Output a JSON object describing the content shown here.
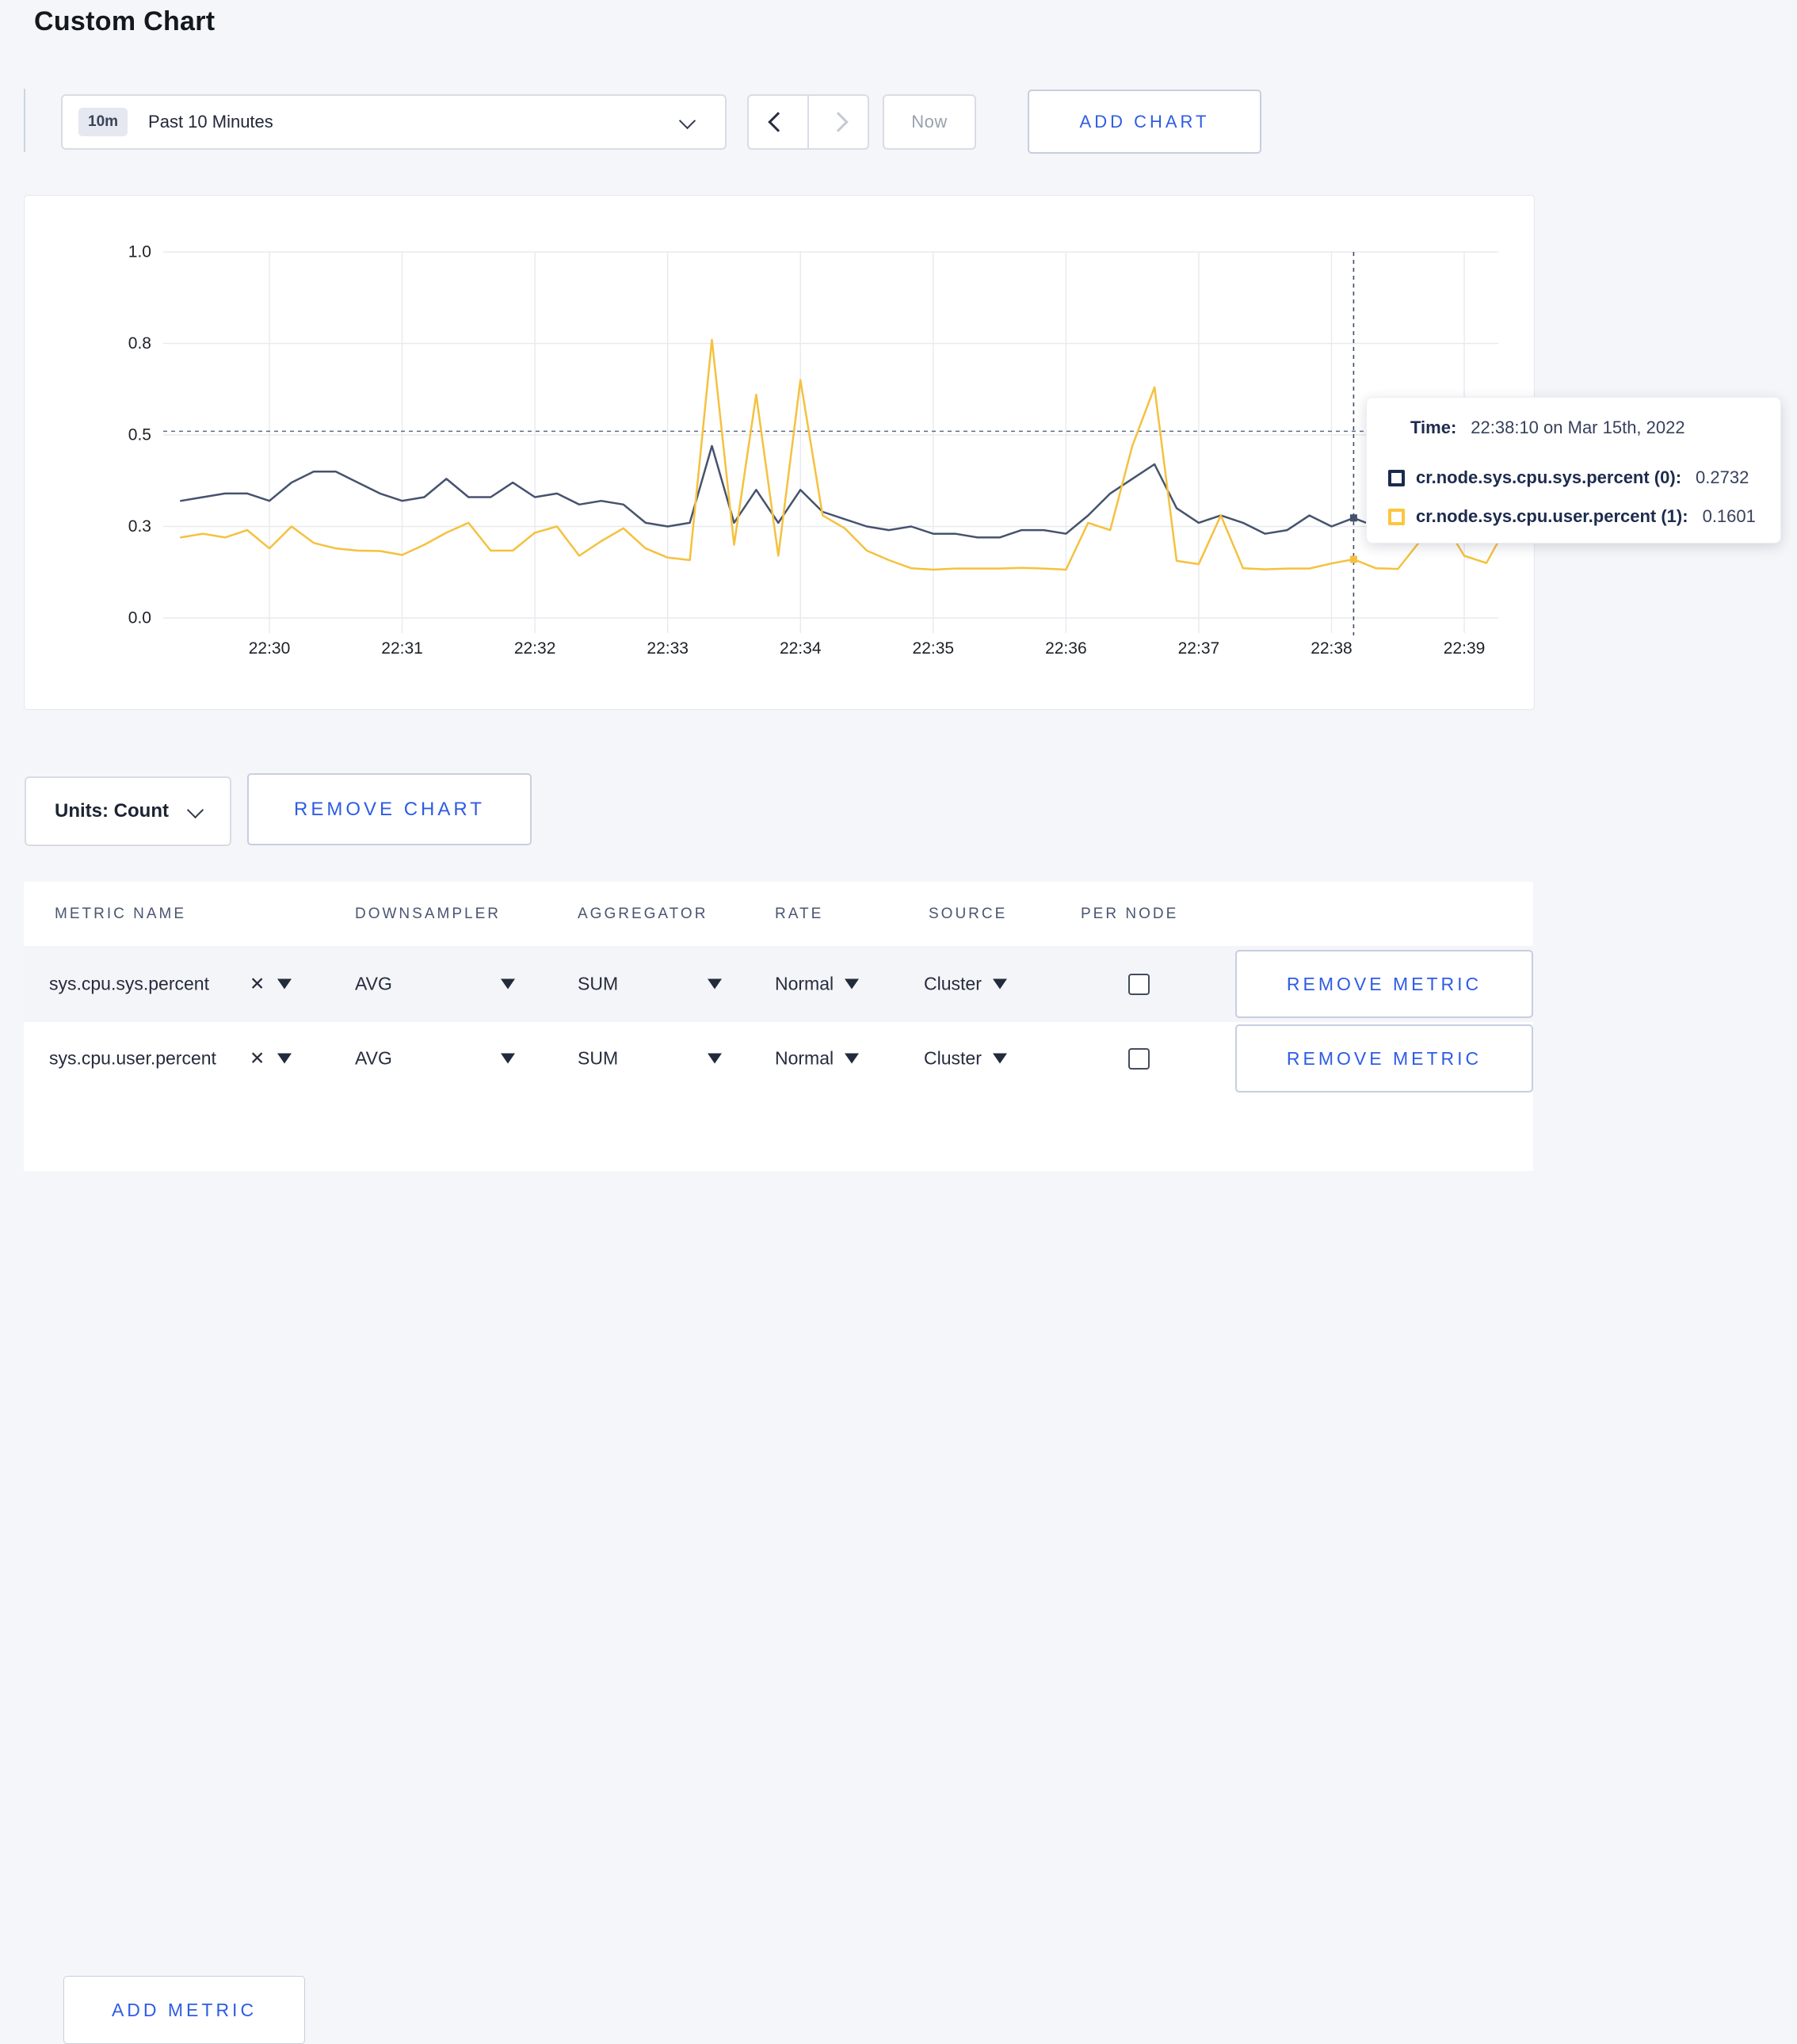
{
  "page": {
    "title": "Custom Chart"
  },
  "colors": {
    "accent_blue": "#2e5ce4",
    "series_sys": "#46536e",
    "series_user": "#f5c13e",
    "tooltip_navy": "#1b2b4e",
    "tooltip_yellow": "#fdc53e"
  },
  "toolbar": {
    "timeframe_badge": "10m",
    "timeframe_label": "Past 10 Minutes",
    "now_label": "Now",
    "add_chart_label": "ADD CHART"
  },
  "tooltip": {
    "time_label": "Time:",
    "time_value": "22:38:10 on Mar 15th, 2022",
    "rows": [
      {
        "label": "cr.node.sys.cpu.sys.percent (0):",
        "value": "0.2732",
        "color": "#1b2b4e"
      },
      {
        "label": "cr.node.sys.cpu.user.percent (1):",
        "value": "0.1601",
        "color": "#fdc53e"
      }
    ]
  },
  "chart_controls": {
    "units_label": "Units: Count",
    "remove_chart_label": "REMOVE CHART"
  },
  "metrics_table": {
    "headers": [
      "METRIC NAME",
      "DOWNSAMPLER",
      "AGGREGATOR",
      "RATE",
      "SOURCE",
      "PER NODE"
    ],
    "rows": [
      {
        "metric": "sys.cpu.sys.percent",
        "downsampler": "AVG",
        "aggregator": "SUM",
        "rate": "Normal",
        "source": "Cluster",
        "per_node": false
      },
      {
        "metric": "sys.cpu.user.percent",
        "downsampler": "AVG",
        "aggregator": "SUM",
        "rate": "Normal",
        "source": "Cluster",
        "per_node": false
      }
    ],
    "remove_metric_label": "REMOVE METRIC",
    "add_metric_label": "ADD METRIC"
  },
  "chart_data": {
    "type": "line",
    "title": "",
    "xlabel": "",
    "ylabel": "",
    "ylim": [
      0,
      1
    ],
    "grid": true,
    "x_ticks": [
      "22:30",
      "22:31",
      "22:32",
      "22:33",
      "22:34",
      "22:35",
      "22:36",
      "22:37",
      "22:38",
      "22:39"
    ],
    "y_ticks": {
      "values": [
        0,
        0.25,
        0.5,
        0.75,
        1.0
      ],
      "labels": [
        "0.0",
        "0.3",
        "0.5",
        "0.8",
        "1.0"
      ]
    },
    "x": [
      "22:29:20",
      "22:29:30",
      "22:29:40",
      "22:29:50",
      "22:30:00",
      "22:30:10",
      "22:30:20",
      "22:30:30",
      "22:30:40",
      "22:30:50",
      "22:31:00",
      "22:31:10",
      "22:31:20",
      "22:31:30",
      "22:31:40",
      "22:31:50",
      "22:32:00",
      "22:32:10",
      "22:32:20",
      "22:32:30",
      "22:32:40",
      "22:32:50",
      "22:33:00",
      "22:33:10",
      "22:33:20",
      "22:33:30",
      "22:33:40",
      "22:33:50",
      "22:34:00",
      "22:34:10",
      "22:34:20",
      "22:34:30",
      "22:34:40",
      "22:34:50",
      "22:35:00",
      "22:35:10",
      "22:35:20",
      "22:35:30",
      "22:35:40",
      "22:35:50",
      "22:36:00",
      "22:36:10",
      "22:36:20",
      "22:36:30",
      "22:36:40",
      "22:36:50",
      "22:37:00",
      "22:37:10",
      "22:37:20",
      "22:37:30",
      "22:37:40",
      "22:37:50",
      "22:38:00",
      "22:38:10",
      "22:38:20",
      "22:38:30",
      "22:38:40",
      "22:38:50",
      "22:39:00",
      "22:39:10",
      "22:39:20"
    ],
    "series": [
      {
        "name": "cr.node.sys.cpu.sys.percent (0)",
        "color": "#46536e",
        "values": [
          0.32,
          0.33,
          0.34,
          0.34,
          0.32,
          0.37,
          0.4,
          0.4,
          0.37,
          0.34,
          0.32,
          0.33,
          0.38,
          0.33,
          0.33,
          0.37,
          0.33,
          0.34,
          0.31,
          0.32,
          0.31,
          0.26,
          0.25,
          0.26,
          0.47,
          0.26,
          0.35,
          0.26,
          0.35,
          0.29,
          0.27,
          0.25,
          0.24,
          0.25,
          0.23,
          0.23,
          0.22,
          0.22,
          0.24,
          0.24,
          0.23,
          0.28,
          0.34,
          0.38,
          0.42,
          0.3,
          0.26,
          0.28,
          0.26,
          0.23,
          0.24,
          0.28,
          0.25,
          0.2732,
          0.25,
          0.26,
          0.28,
          0.3,
          0.3,
          0.31,
          0.3
        ]
      },
      {
        "name": "cr.node.sys.cpu.user.percent (1)",
        "color": "#f5c13e",
        "values": [
          0.22,
          0.23,
          0.22,
          0.24,
          0.19,
          0.25,
          0.205,
          0.19,
          0.184,
          0.183,
          0.172,
          0.2,
          0.233,
          0.26,
          0.184,
          0.184,
          0.233,
          0.25,
          0.17,
          0.21,
          0.245,
          0.19,
          0.165,
          0.158,
          0.76,
          0.2,
          0.61,
          0.17,
          0.65,
          0.28,
          0.245,
          0.184,
          0.158,
          0.136,
          0.132,
          0.135,
          0.135,
          0.135,
          0.137,
          0.135,
          0.132,
          0.26,
          0.24,
          0.47,
          0.63,
          0.156,
          0.147,
          0.28,
          0.136,
          0.133,
          0.135,
          0.135,
          0.149,
          0.1601,
          0.136,
          0.134,
          0.21,
          0.27,
          0.17,
          0.15,
          0.26
        ]
      }
    ],
    "crosshair": {
      "time": "22:38:10",
      "guide_value": 0.51,
      "dot_values": [
        0.2732,
        0.1601
      ]
    }
  }
}
